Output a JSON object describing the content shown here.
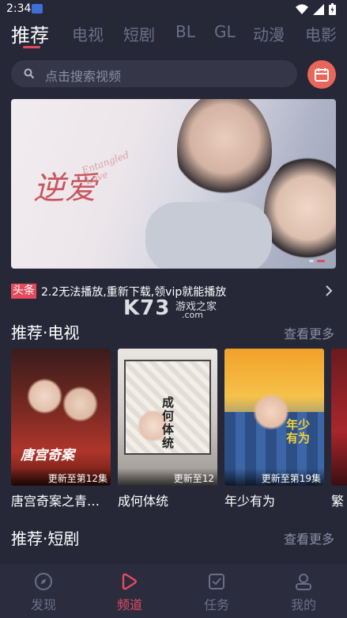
{
  "status_bar": {
    "time": "2:34"
  },
  "tabs": [
    {
      "label": "推荐",
      "active": true
    },
    {
      "label": "电视"
    },
    {
      "label": "短剧"
    },
    {
      "label": "BL"
    },
    {
      "label": "GL"
    },
    {
      "label": "动漫"
    },
    {
      "label": "电影"
    }
  ],
  "search": {
    "placeholder": "点击搜索视频"
  },
  "banner": {
    "title_art": "逆爱",
    "caption_art": "Entangled Love"
  },
  "notice": {
    "tag": "头条",
    "text": "2.2无法播放,重新下载,领vip就能播放"
  },
  "watermark": {
    "brand": "K73",
    "site_name": "游戏之家",
    "domain": ".com"
  },
  "sections": {
    "tv": {
      "title": "推荐·电视",
      "more": "查看更多"
    },
    "short": {
      "title": "推荐·短剧",
      "more": "查看更多"
    }
  },
  "tv_cards": [
    {
      "name": "唐宫奇案之青…",
      "badge": "更新至第12集",
      "poster_text": "唐宫奇案"
    },
    {
      "name": "成何体统",
      "badge": "更新至12",
      "poster_text": "成何体统"
    },
    {
      "name": "年少有为",
      "badge": "更新至第19集",
      "poster_text": "年少有为"
    },
    {
      "name": "繁",
      "badge": ""
    }
  ],
  "bottom_nav": [
    {
      "label": "发现",
      "icon": "compass-icon"
    },
    {
      "label": "频道",
      "icon": "play-icon",
      "active": true
    },
    {
      "label": "任务",
      "icon": "task-icon"
    },
    {
      "label": "我的",
      "icon": "person-icon"
    }
  ],
  "colors": {
    "accent": "#e34a5e",
    "background": "#262838",
    "muted": "#6b6f86"
  }
}
